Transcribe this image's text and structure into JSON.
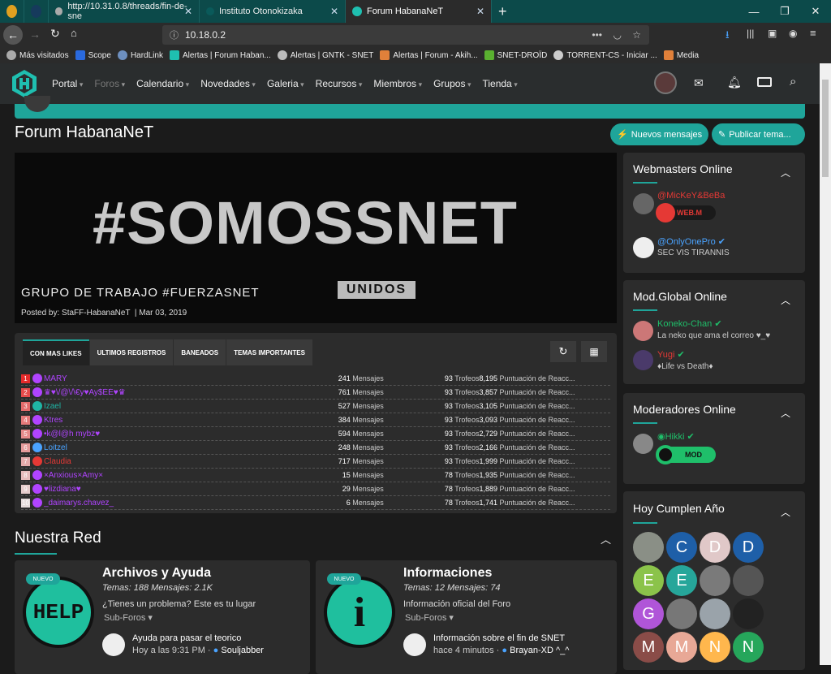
{
  "browser": {
    "tabs": [
      {
        "title": "http://10.31.0.8/threads/fin-de-sne"
      },
      {
        "title": "Instituto Otonokizaka"
      },
      {
        "title": "Forum HabanaNeT"
      }
    ],
    "url": "10.18.0.2",
    "bookmarks": [
      "Más visitados",
      "Scope",
      "HardLink",
      "Alertas | Forum Haban...",
      "Alertas | GNTK - SNET",
      "Alertas | Forum - Akih...",
      "SNET-DROÏD",
      "TORRENT-CS - Iniciar ...",
      "Media"
    ]
  },
  "nav": {
    "items": [
      "Portal",
      "Foros",
      "Calendario",
      "Novedades",
      "Galeria",
      "Recursos",
      "Miembros",
      "Grupos",
      "Tienda"
    ]
  },
  "page": {
    "title": "Forum HabanaNeT",
    "new_posts": "Nuevos mensajes",
    "post_thread": "Publicar tema..."
  },
  "banner": {
    "main": "#SOMOSSNET",
    "sub": "UNIDOS",
    "caption": "GRUPO DE TRABAJO #FUERZASNET",
    "posted_by": "Posted by:",
    "author": "StaFF-HabanaNeT",
    "date": "Mar 03, 2019"
  },
  "leaderboard": {
    "tabs": [
      "CON MAS LIKES",
      "ULTIMOS REGISTROS",
      "BANEADOS",
      "TEMAS IMPORTANTES"
    ],
    "rows": [
      {
        "rank": "1",
        "name": "MARY",
        "count": "241",
        "unit": "Mensajes",
        "trophies": "93",
        "tr": "Trofeos",
        "points": "8,195",
        "pl": "Puntuación de Reacc...",
        "color": "#b044ff",
        "bcolor": "#e52b2b"
      },
      {
        "rank": "2",
        "name": "♛♥\\/@\\/\\€y♥Ay$ÉÉ♥♛",
        "count": "761",
        "unit": "Mensajes",
        "trophies": "93",
        "tr": "Trofeos",
        "points": "3,857",
        "pl": "Puntuación de Reacc...",
        "color": "#b044ff",
        "bcolor": "#e54b4b"
      },
      {
        "rank": "3",
        "name": "Izael",
        "count": "527",
        "unit": "Mensajes",
        "trophies": "93",
        "tr": "Trofeos",
        "points": "3,105",
        "pl": "Puntuación de Reacc...",
        "color": "#1fb5a5",
        "bcolor": "#e56b6b"
      },
      {
        "rank": "4",
        "name": "Ktres",
        "count": "384",
        "unit": "Mensajes",
        "trophies": "93",
        "tr": "Trofeos",
        "points": "3,093",
        "pl": "Puntuación de Reacc...",
        "color": "#b044ff",
        "bcolor": "#e57b7b"
      },
      {
        "rank": "5",
        "name": "•k@l@h mybz♥",
        "count": "594",
        "unit": "Mensajes",
        "trophies": "93",
        "tr": "Trofeos",
        "points": "2,729",
        "pl": "Puntuación de Reacc...",
        "color": "#b044ff",
        "bcolor": "#e58b8b"
      },
      {
        "rank": "6",
        "name": "Loitzel",
        "count": "248",
        "unit": "Mensajes",
        "trophies": "93",
        "tr": "Trofeos",
        "points": "2,166",
        "pl": "Puntuación de Reacc...",
        "color": "#4aa3ff",
        "bcolor": "#e59b9b"
      },
      {
        "rank": "7",
        "name": "Claudia",
        "count": "717",
        "unit": "Mensajes",
        "trophies": "93",
        "tr": "Trofeos",
        "points": "1,999",
        "pl": "Puntuación de Reacc...",
        "color": "#e53935",
        "bcolor": "#e5abab"
      },
      {
        "rank": "8",
        "name": "×Anxious×Amy×",
        "count": "15",
        "unit": "Mensajes",
        "trophies": "78",
        "tr": "Trofeos",
        "points": "1,935",
        "pl": "Puntuación de Reacc...",
        "color": "#b044ff",
        "bcolor": "#e5bbbb"
      },
      {
        "rank": "9",
        "name": "♥lizdiana♥",
        "count": "29",
        "unit": "Mensajes",
        "trophies": "78",
        "tr": "Trofeos",
        "points": "1,889",
        "pl": "Puntuación de Reacc...",
        "color": "#b044ff",
        "bcolor": "#e5cbcb"
      },
      {
        "rank": "10",
        "name": "_daimarys.chavez_",
        "count": "6",
        "unit": "Mensajes",
        "trophies": "78",
        "tr": "Trofeos",
        "points": "1,741",
        "pl": "Puntuación de Reacc...",
        "color": "#b044ff",
        "bcolor": "#e5dbdb"
      }
    ]
  },
  "network": {
    "title": "Nuestra Red",
    "forums": [
      {
        "badge": "NUEVO",
        "icon_text": "HELP",
        "title": "Archivos y Ayuda",
        "stats": "Temas: 188 Mensajes: 2.1K",
        "desc": "¿Tienes un problema? Este es tu lugar",
        "sub": "Sub-Foros",
        "last_title": "Ayuda para pasar el teorico",
        "last_time": "Hoy a las 9:31 PM",
        "last_user": "Souljabber"
      },
      {
        "badge": "NUEVO",
        "icon_text": "i",
        "title": "Informaciones",
        "stats": "Temas: 12 Mensajes: 74",
        "desc": "Información oficial del Foro",
        "sub": "Sub-Foros",
        "last_title": "Información sobre el fin de SNET",
        "last_time": "hace 4 minutos",
        "last_user": "Brayan-XD ^_^"
      }
    ]
  },
  "sidebar": {
    "webmasters": {
      "title": "Webmasters Online",
      "users": [
        {
          "name": "@MicKeY&BeBa",
          "badge": "WEB.M"
        },
        {
          "name": "@OnlyOnePro",
          "status": "SEC VIS TIRANNIS"
        }
      ]
    },
    "modglobal": {
      "title": "Mod.Global Online",
      "users": [
        {
          "name": "Koneko-Chan",
          "status": "La neko que ama el correo ♥_♥"
        },
        {
          "name": "Yugi",
          "status": "♦Life vs Death♦"
        }
      ]
    },
    "moderators": {
      "title": "Moderadores Online",
      "users": [
        {
          "name": "Hikki",
          "badge": "MOD"
        }
      ]
    },
    "birthdays": {
      "title": "Hoy Cumplen Año",
      "avatars": [
        {
          "l": "",
          "c": "#8a8f86"
        },
        {
          "l": "C",
          "c": "#1e5fa8"
        },
        {
          "l": "D",
          "c": "#e0c8c8"
        },
        {
          "l": "D",
          "c": "#1e5fa8"
        },
        {
          "l": "E",
          "c": "#8bc34a"
        },
        {
          "l": "E",
          "c": "#26a69a"
        },
        {
          "l": "",
          "c": "#7a7a7a"
        },
        {
          "l": "",
          "c": "#555"
        },
        {
          "l": "G",
          "c": "#b055d8"
        },
        {
          "l": "",
          "c": "#777"
        },
        {
          "l": "",
          "c": "#9aa3aa"
        },
        {
          "l": "",
          "c": "#222"
        },
        {
          "l": "M",
          "c": "#8a4c48"
        },
        {
          "l": "M",
          "c": "#e8a896"
        },
        {
          "l": "N",
          "c": "#ffb74d"
        },
        {
          "l": "N",
          "c": "#26a65b"
        }
      ]
    }
  }
}
